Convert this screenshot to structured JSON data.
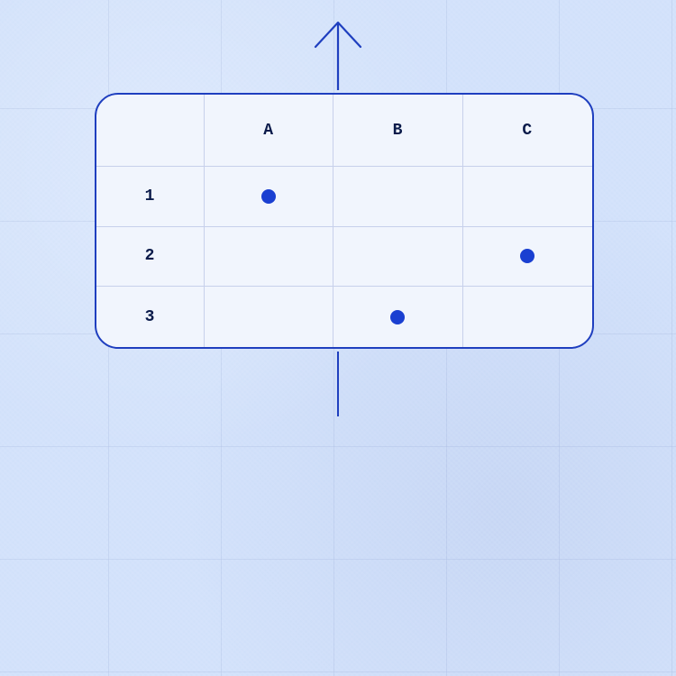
{
  "columns": [
    "A",
    "B",
    "C"
  ],
  "rows": [
    "1",
    "2",
    "3"
  ],
  "dots": {
    "r1_A": true,
    "r1_B": false,
    "r1_C": false,
    "r2_A": false,
    "r2_B": false,
    "r2_C": true,
    "r3_A": false,
    "r3_B": true,
    "r3_C": false
  },
  "colors": {
    "accent": "#1f3fbf",
    "dot": "#1a3fd1",
    "card_bg": "#f1f5fd",
    "page_bg": "#d3e2fb"
  }
}
